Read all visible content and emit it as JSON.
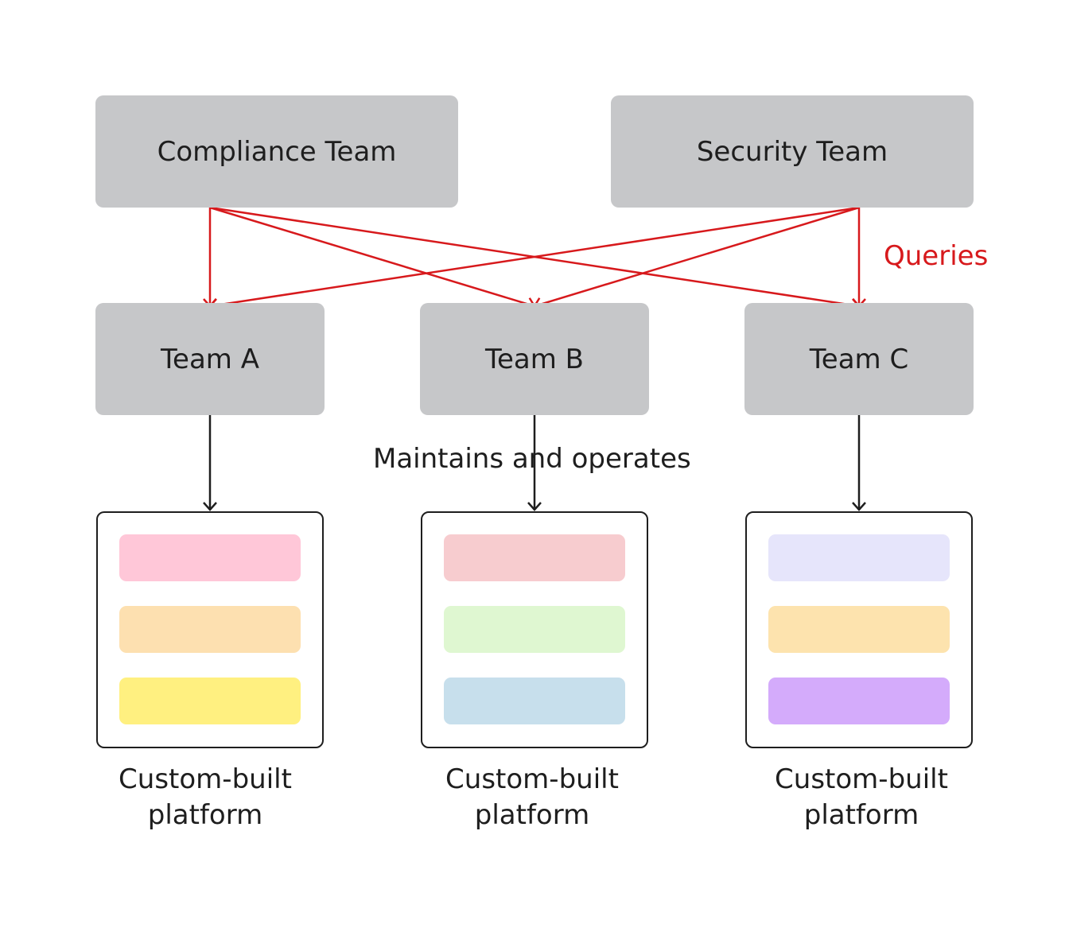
{
  "top_teams": [
    {
      "label": "Compliance Team"
    },
    {
      "label": "Security Team"
    }
  ],
  "teams": [
    {
      "label": "Team A"
    },
    {
      "label": "Team B"
    },
    {
      "label": "Team C"
    }
  ],
  "queries_label": "Queries",
  "maintains_label": "Maintains and operates",
  "platforms": [
    {
      "line1": "Custom-built",
      "line2": "platform",
      "colors": [
        "#ffc7d8",
        "#fde0b0",
        "#fff080"
      ]
    },
    {
      "line1": "Custom-built",
      "line2": "platform",
      "colors": [
        "#f7cccf",
        "#dff7d1",
        "#c7dfec"
      ]
    },
    {
      "line1": "Custom-built",
      "line2": "platform",
      "colors": [
        "#e6e5fb",
        "#fde3ae",
        "#d4abfb"
      ]
    }
  ],
  "colors": {
    "query_arrow": "#d7191c",
    "maintain_arrow": "#1e1e1e",
    "box": "#c6c7c9"
  }
}
